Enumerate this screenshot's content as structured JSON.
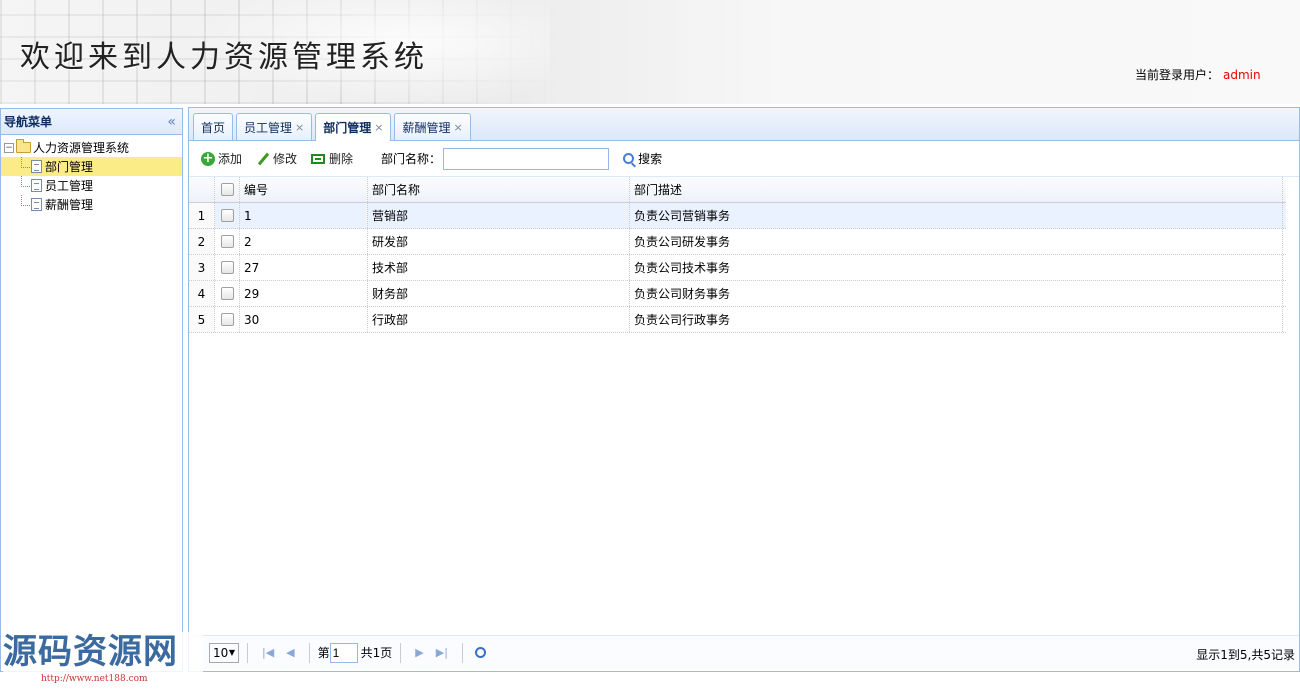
{
  "header": {
    "title": "欢迎来到人力资源管理系统",
    "login_label": "当前登录用户：",
    "login_user": "admin"
  },
  "nav": {
    "title": "导航菜单",
    "collapse_icon": "«",
    "root": "人力资源管理系统",
    "items": [
      "部门管理",
      "员工管理",
      "薪酬管理"
    ]
  },
  "tabs": [
    {
      "label": "首页",
      "closable": false
    },
    {
      "label": "员工管理",
      "closable": true
    },
    {
      "label": "部门管理",
      "closable": true,
      "active": true
    },
    {
      "label": "薪酬管理",
      "closable": true
    }
  ],
  "toolbar": {
    "add": "添加",
    "edit": "修改",
    "delete": "删除",
    "search_label": "部门名称：",
    "search_value": "",
    "search_button": "搜索"
  },
  "grid": {
    "columns": [
      "编号",
      "部门名称",
      "部门描述"
    ],
    "rows": [
      {
        "num": "1",
        "id": "1",
        "name": "营销部",
        "desc": "负责公司营销事务"
      },
      {
        "num": "2",
        "id": "2",
        "name": "研发部",
        "desc": "负责公司研发事务"
      },
      {
        "num": "3",
        "id": "27",
        "name": "技术部",
        "desc": "负责公司技术事务"
      },
      {
        "num": "4",
        "id": "29",
        "name": "财务部",
        "desc": "负责公司财务事务"
      },
      {
        "num": "5",
        "id": "30",
        "name": "行政部",
        "desc": "负责公司行政事务"
      }
    ]
  },
  "pager": {
    "page_size": "10",
    "page_prefix": "第",
    "page_value": "1",
    "page_total": "共1页",
    "info": "显示1到5,共5记录"
  },
  "watermark": {
    "big": "源码资源网",
    "small": "http://www.net188.com"
  }
}
